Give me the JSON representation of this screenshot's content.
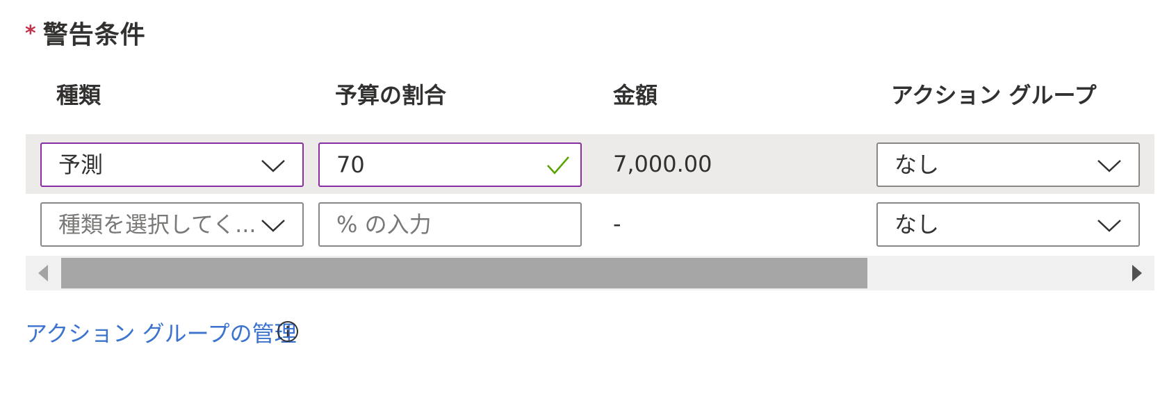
{
  "section": {
    "required_mark": "*",
    "title": "警告条件"
  },
  "table": {
    "headers": [
      "種類",
      "予算の割合",
      "金額",
      "アクション グループ"
    ],
    "rows": [
      {
        "type": "予測",
        "percent_value": "70",
        "percent_placeholder": "",
        "amount": "7,000.00",
        "action_group": "なし",
        "state": "selected"
      },
      {
        "type": "種類を選択してく...",
        "percent_value": "",
        "percent_placeholder": "% の入力",
        "amount": "-",
        "action_group": "なし",
        "state": "empty"
      }
    ]
  },
  "link": {
    "manage_action_groups": "アクション グループの管理"
  },
  "icons": {
    "chevron": "chevron-down-icon",
    "check": "checkmark-icon",
    "info": "info-icon",
    "scroll_left": "scroll-left-arrow-icon",
    "scroll_right": "scroll-right-arrow-icon"
  },
  "colors": {
    "required": "#c4314b",
    "focus_border": "#8a2da5",
    "check": "#57a300",
    "link": "#3b73cf",
    "selected_row_bg": "#edebe9"
  }
}
